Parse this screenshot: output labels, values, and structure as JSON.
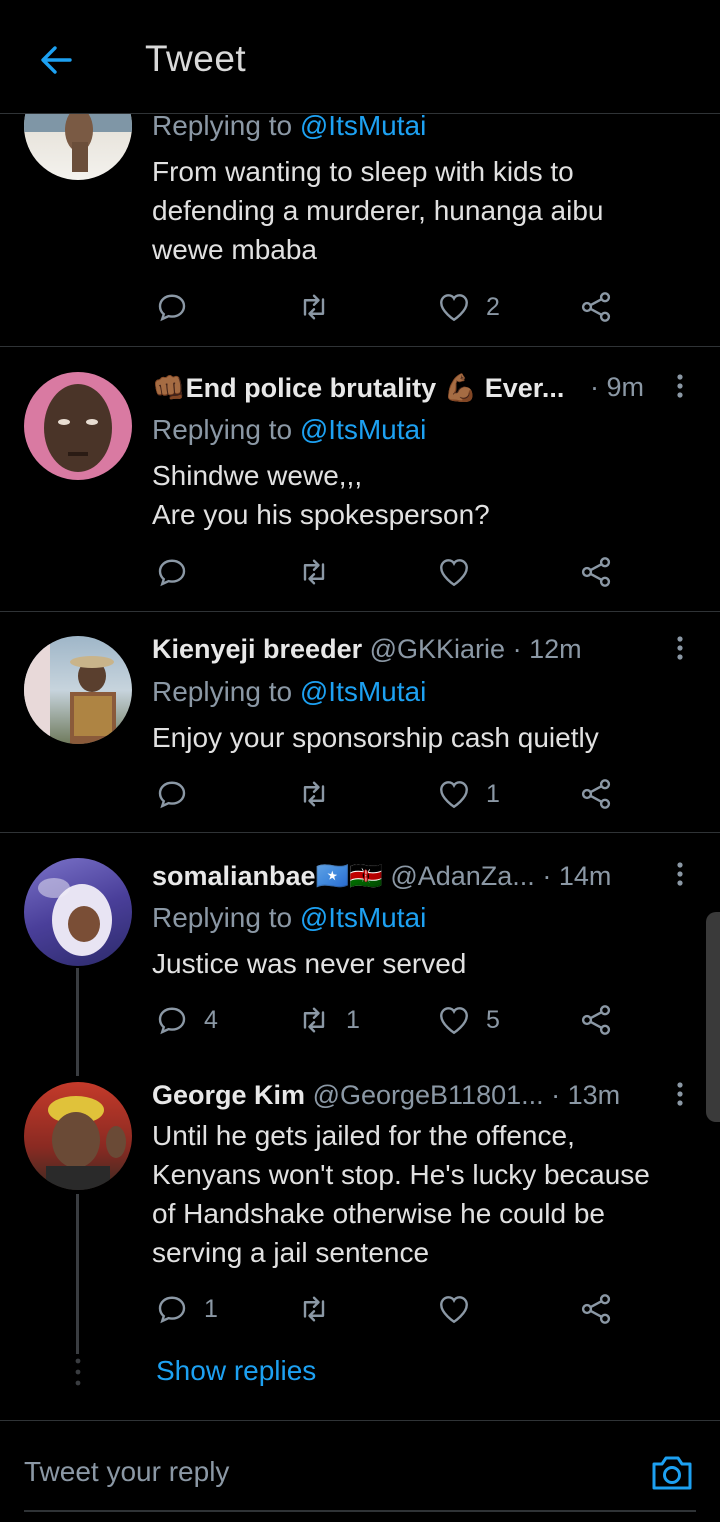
{
  "header": {
    "title": "Tweet"
  },
  "tweets": [
    {
      "name": "",
      "handle": "",
      "time": "",
      "replying_prefix": "Replying to ",
      "replying_to": "@ItsMutai",
      "lines": [
        "From wanting to sleep with kids to",
        "defending a murderer, hunanga aibu",
        "wewe mbaba"
      ],
      "replies": "",
      "retweets": "",
      "likes": "2"
    },
    {
      "name": "👊🏾End police brutality 💪🏾 Ever...",
      "handle": "",
      "time": "· 9m",
      "replying_prefix": "Replying to ",
      "replying_to": "@ItsMutai",
      "lines": [
        "Shindwe wewe,,,",
        "Are you his spokesperson?"
      ],
      "replies": "",
      "retweets": "",
      "likes": ""
    },
    {
      "name": "Kienyeji breeder",
      "handle": "@GKKiarie",
      "time": "· 12m",
      "replying_prefix": "Replying to ",
      "replying_to": "@ItsMutai",
      "lines": [
        "Enjoy your sponsorship cash quietly"
      ],
      "replies": "",
      "retweets": "",
      "likes": "1"
    },
    {
      "name": "somalianbae🇸🇴🇰🇪",
      "handle": "@AdanZa...",
      "time": "· 14m",
      "replying_prefix": "Replying to ",
      "replying_to": "@ItsMutai",
      "lines": [
        "Justice was never served"
      ],
      "replies": "4",
      "retweets": "1",
      "likes": "5"
    },
    {
      "name": "George Kim",
      "handle": "@GeorgeB11801...",
      "time": "· 13m",
      "lines": [
        "Until he gets jailed for the offence,",
        "Kenyans won't stop. He's lucky because",
        "of Handshake otherwise he could be",
        "serving a jail sentence"
      ],
      "replies": "1",
      "retweets": "",
      "likes": ""
    }
  ],
  "show_replies": "Show replies",
  "reply_bar": {
    "placeholder": "Tweet your reply"
  },
  "colors": {
    "accent": "#1da1f2",
    "background": "#000000",
    "muted": "#8b98a5",
    "text": "#e1e1e1"
  },
  "icons": [
    "back-arrow-icon",
    "more-vertical-icon",
    "reply-icon",
    "retweet-icon",
    "like-icon",
    "share-icon",
    "camera-icon"
  ]
}
